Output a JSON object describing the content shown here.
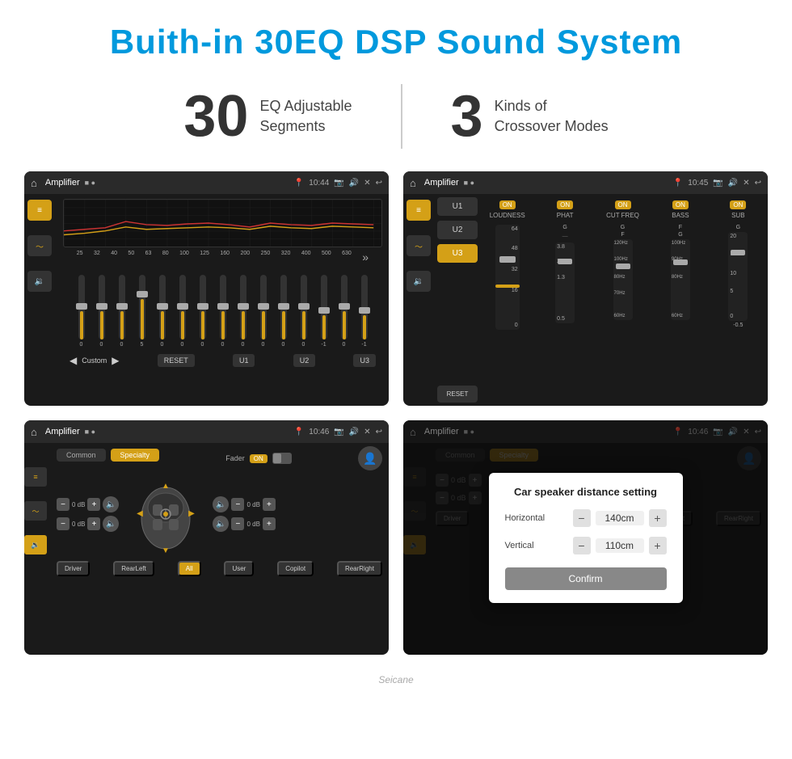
{
  "page": {
    "title": "Buith-in 30EQ DSP Sound System",
    "stats": [
      {
        "number": "30",
        "text_line1": "EQ Adjustable",
        "text_line2": "Segments"
      },
      {
        "number": "3",
        "text_line1": "Kinds of",
        "text_line2": "Crossover Modes"
      }
    ],
    "divider": "|"
  },
  "screen1": {
    "topbar": {
      "title": "Amplifier",
      "time": "10:44"
    },
    "eq_labels": [
      "25",
      "32",
      "40",
      "50",
      "63",
      "80",
      "100",
      "125",
      "160",
      "200",
      "250",
      "320",
      "400",
      "500",
      "630"
    ],
    "eq_values": [
      "0",
      "0",
      "0",
      "5",
      "0",
      "0",
      "0",
      "0",
      "0",
      "0",
      "0",
      "0",
      "-1",
      "0",
      "-1"
    ],
    "bottom_buttons": [
      "Custom",
      "RESET",
      "U1",
      "U2",
      "U3"
    ]
  },
  "screen2": {
    "topbar": {
      "title": "Amplifier",
      "time": "10:45"
    },
    "preset_btns": [
      "U1",
      "U2",
      "U3"
    ],
    "active_preset": "U3",
    "channels": [
      "LOUDNESS",
      "PHAT",
      "CUT FREQ",
      "BASS",
      "SUB"
    ],
    "on_labels": [
      "ON",
      "ON",
      "ON",
      "ON",
      "ON"
    ],
    "reset_btn": "RESET"
  },
  "screen3": {
    "topbar": {
      "title": "Amplifier",
      "time": "10:46"
    },
    "tabs": [
      "Common",
      "Specialty"
    ],
    "active_tab": "Specialty",
    "fader_label": "Fader",
    "fader_on": "ON",
    "vol_cols": [
      {
        "top": "0 dB",
        "bottom": "0 dB"
      },
      {
        "top": "0 dB",
        "bottom": "0 dB"
      }
    ],
    "buttons": {
      "row1": [
        "Driver",
        "RearLeft",
        "All",
        "User",
        "RearRight"
      ],
      "bottom_btns": [
        "Driver",
        "RearLeft",
        "All",
        "User",
        "RearRight",
        "Copilot"
      ]
    },
    "copilot": "Copilot"
  },
  "screen4": {
    "topbar": {
      "title": "Amplifier",
      "time": "10:46"
    },
    "tabs": [
      "Common",
      "Specialty"
    ],
    "dialog": {
      "title": "Car speaker distance setting",
      "rows": [
        {
          "label": "Horizontal",
          "value": "140cm"
        },
        {
          "label": "Vertical",
          "value": "110cm"
        }
      ],
      "confirm_btn": "Confirm"
    }
  },
  "footer": "Seicane"
}
